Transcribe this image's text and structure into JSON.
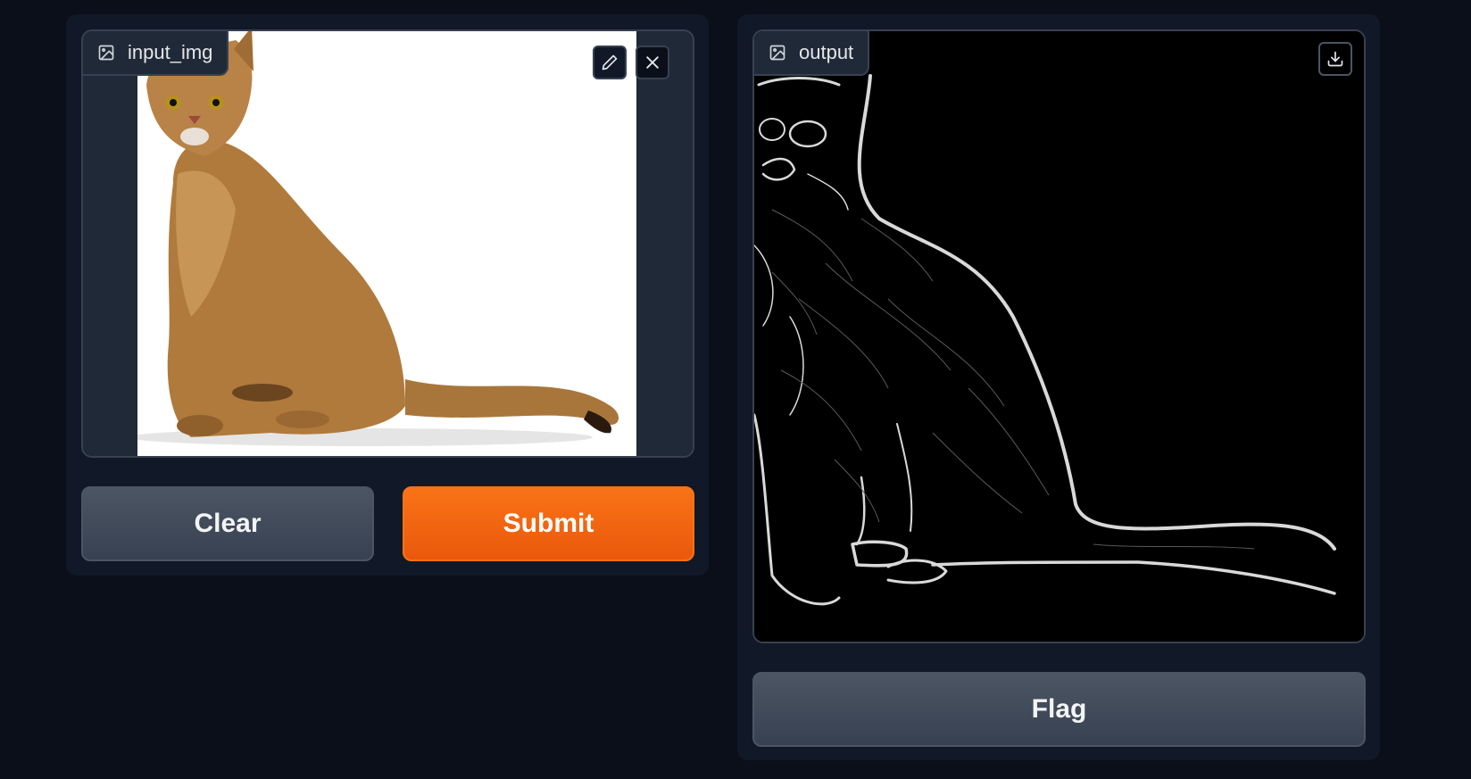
{
  "input_panel": {
    "label": "input_img",
    "clear_label": "Clear",
    "submit_label": "Submit"
  },
  "output_panel": {
    "label": "output",
    "flag_label": "Flag"
  },
  "colors": {
    "background": "#0b0f19",
    "panel": "#111827",
    "block": "#1f2937",
    "border": "#374151",
    "primary": "#f97316",
    "secondary": "#4b5563"
  },
  "icons": {
    "label_icon": "image-icon",
    "edit": "pencil-icon",
    "close": "close-icon",
    "download": "download-icon"
  }
}
